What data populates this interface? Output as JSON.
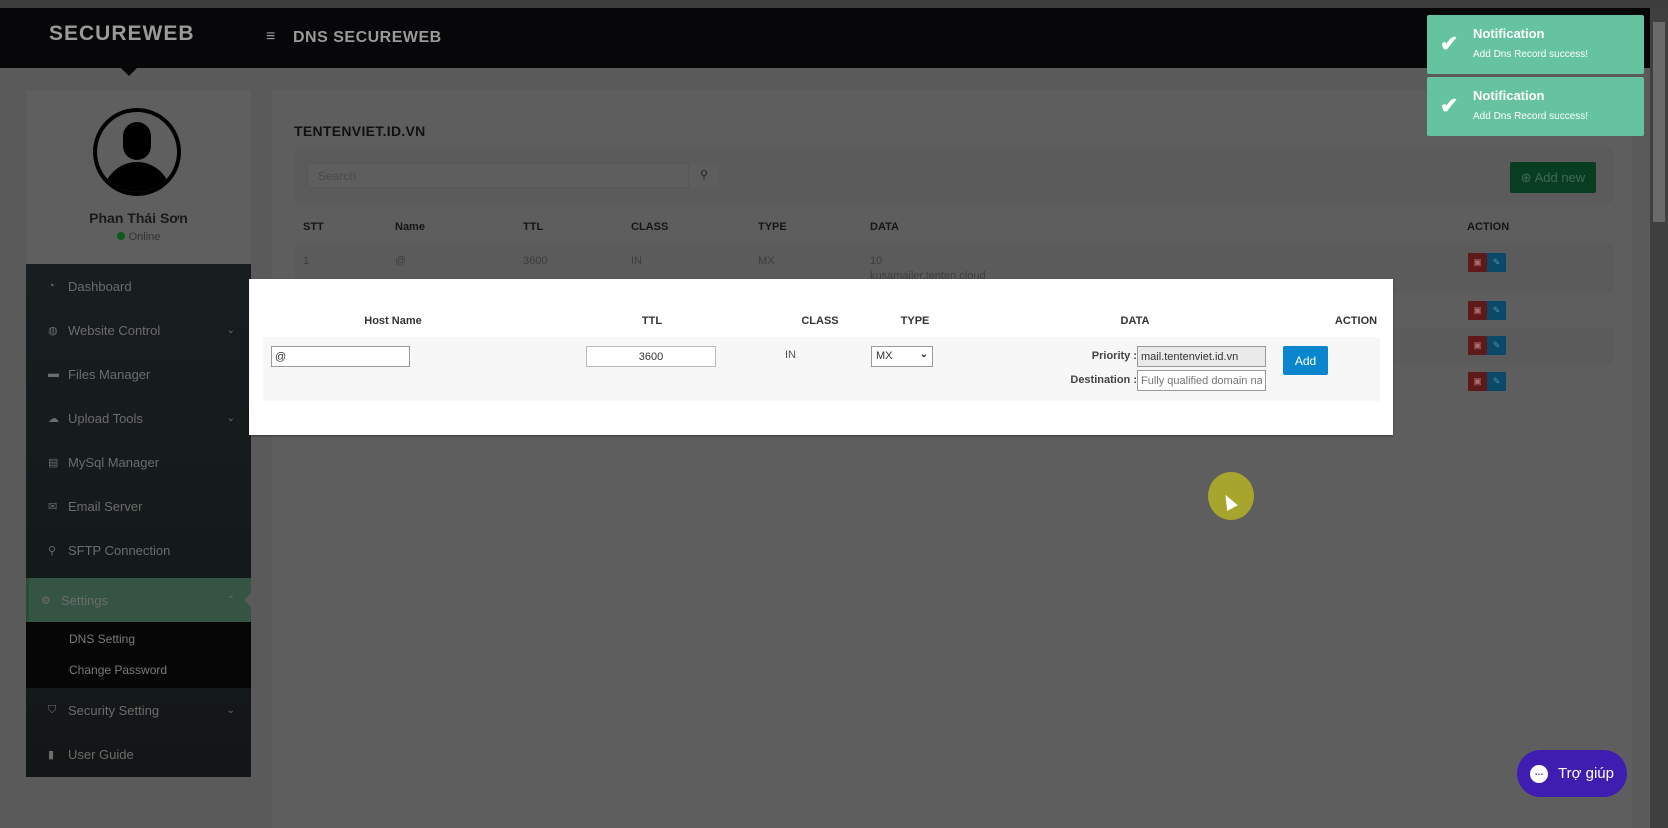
{
  "header": {
    "logo": "SECUREWEB",
    "title": "DNS SECUREWEB",
    "menu_icon": "hamburger-icon"
  },
  "profile": {
    "name": "Phan Thái Sơn",
    "status": "Online"
  },
  "sidebar": {
    "items": [
      {
        "label": "Dashboard",
        "icon": "◔"
      },
      {
        "label": "Website Control",
        "icon": "◍",
        "chevron": "⌄"
      },
      {
        "label": "Files Manager",
        "icon": "▬"
      },
      {
        "label": "Upload Tools",
        "icon": "☁",
        "chevron": "⌄"
      },
      {
        "label": "MySql Manager",
        "icon": "▤"
      },
      {
        "label": "Email Server",
        "icon": "✉"
      },
      {
        "label": "SFTP Connection",
        "icon": "⚲"
      },
      {
        "label": "Settings",
        "icon": "⚙",
        "chevron": "⌃"
      },
      {
        "label": "Security Setting",
        "icon": "⛉",
        "chevron": "⌄"
      },
      {
        "label": "User Guide",
        "icon": "▮"
      }
    ],
    "submenu": [
      "DNS Setting",
      "Change Password"
    ]
  },
  "main": {
    "domain": "TENTENVIET.ID.VN",
    "search_placeholder": "Search",
    "add_new": "⊕ Add new",
    "columns": [
      "STT",
      "Name",
      "TTL",
      "CLASS",
      "TYPE",
      "DATA",
      "ACTION"
    ],
    "rows": [
      {
        "stt": "1",
        "name": "@",
        "ttl": "3600",
        "class": "IN",
        "type": "MX",
        "data": "10",
        "data2": "kusamailer.tenten.cloud"
      }
    ]
  },
  "modal": {
    "columns": [
      "Host Name",
      "TTL",
      "CLASS",
      "TYPE",
      "DATA",
      "ACTION"
    ],
    "host_value": "@",
    "ttl_value": "3600",
    "class_value": "IN",
    "type_value": "MX",
    "priority_label": "Priority :",
    "priority_value": "mail.tentenviet.id.vn",
    "destination_label": "Destination :",
    "destination_placeholder": "Fully qualified domain name",
    "add_label": "Add"
  },
  "notifications": [
    {
      "title": "Notification",
      "message": "Add Dns Record success!"
    },
    {
      "title": "Notification",
      "message": "Add Dns Record success!"
    }
  ],
  "help": {
    "label": "Trợ giúp"
  },
  "colors": {
    "notification": "#65c39f",
    "help": "#3f1db0",
    "add_button": "#0a86cf",
    "settings_active": "#355443"
  }
}
